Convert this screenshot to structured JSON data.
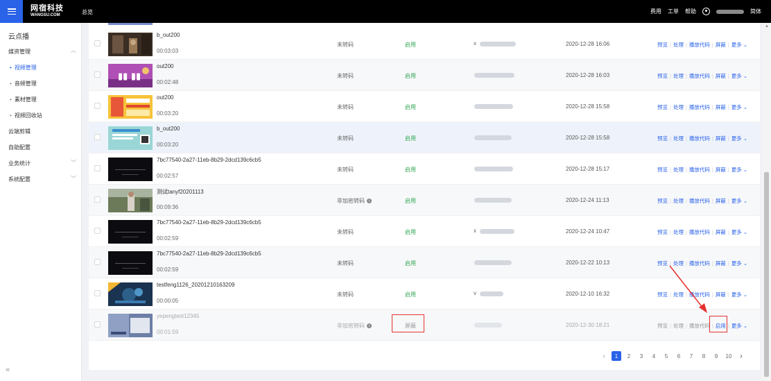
{
  "header": {
    "logo_cn": "网宿科技",
    "logo_en": "WANGSU.COM",
    "overview": "总览",
    "links": [
      "费用",
      "工单",
      "帮助"
    ],
    "lang": "简体"
  },
  "sidebar": {
    "title": "云点播",
    "items": [
      {
        "label": "媒资管理",
        "type": "group"
      },
      {
        "label": "视频管理",
        "type": "sub",
        "active": true
      },
      {
        "label": "音频管理",
        "type": "sub"
      },
      {
        "label": "素材管理",
        "type": "sub"
      },
      {
        "label": "视频回收站",
        "type": "sub"
      },
      {
        "label": "云端剪辑",
        "type": "item"
      },
      {
        "label": "自助配置",
        "type": "item"
      },
      {
        "label": "业务统计",
        "type": "group"
      },
      {
        "label": "系统配置",
        "type": "group"
      }
    ]
  },
  "actions": {
    "preview": "预览",
    "process": "处理",
    "play_code": "播放代码",
    "block": "屏蔽",
    "enable": "启用",
    "more": "更多"
  },
  "rows": [
    {
      "name": "b_out200",
      "duration": "00:03:03",
      "transcode": "未转码",
      "status": "启用",
      "domain_prefix": "x",
      "date": "2020-12-28 16:06"
    },
    {
      "name": "out200",
      "duration": "00:02:48",
      "transcode": "未转码",
      "status": "启用",
      "domain_prefix": "",
      "date": "2020-12-28 16:03"
    },
    {
      "name": "out200",
      "duration": "00:03:20",
      "transcode": "未转码",
      "status": "启用",
      "domain_prefix": "",
      "date": "2020-12-28 15:58"
    },
    {
      "name": "b_out200",
      "duration": "00:03:20",
      "transcode": "未转码",
      "status": "启用",
      "domain_prefix": "",
      "date": "2020-12-28 15:58"
    },
    {
      "name": "7bc77540-2a27-11eb-8b29-2dcd139c6cb5",
      "duration": "00:02:57",
      "transcode": "未转码",
      "status": "启用",
      "domain_prefix": "",
      "date": "2020-12-28 15:17"
    },
    {
      "name": "测试tanyf20201113",
      "duration": "00:09:36",
      "transcode": "非加密转码",
      "status": "启用",
      "domain_prefix": "",
      "date": "2020-12-24 11:13"
    },
    {
      "name": "7bc77540-2a27-11eb-8b29-2dcd139c6cb5",
      "duration": "00:02:59",
      "transcode": "未转码",
      "status": "启用",
      "domain_prefix": "x",
      "date": "2020-12-24 10:47"
    },
    {
      "name": "7bc77540-2a27-11eb-8b29-2dcd139c6cb5",
      "duration": "00:02:59",
      "transcode": "未转码",
      "status": "启用",
      "domain_prefix": "",
      "date": "2020-12-22 10:13"
    },
    {
      "name": "testfeng1126_20201210163209",
      "duration": "00:00:05",
      "transcode": "未转码",
      "status": "启用",
      "domain_prefix": "v",
      "date": "2020-12-10 16:32"
    },
    {
      "name": "yepengtest12345",
      "duration": "00:01:59",
      "transcode": "非加密转码",
      "status": "屏蔽",
      "domain_prefix": "",
      "date": "2020-12-30 18:21"
    }
  ],
  "pagination": {
    "pages": [
      "1",
      "2",
      "3",
      "4",
      "5",
      "6",
      "7",
      "8",
      "9",
      "10"
    ],
    "current": "1",
    "prev": "‹",
    "next": "›"
  },
  "colors": {
    "accent": "#2a63e8",
    "enabled_green": "#33a853",
    "annotation_red": "#e5312e"
  }
}
